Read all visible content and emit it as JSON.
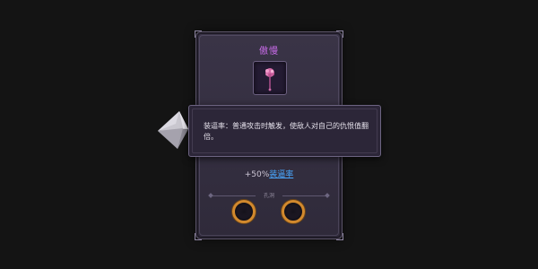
{
  "item": {
    "title": "傲慢",
    "icon": "pink-mace-staff-icon"
  },
  "tooltip": {
    "text": "装逼率：普通攻击时触发，使敌人对自己的仇恨值翻倍。"
  },
  "stat": {
    "value": "+50%",
    "link_label": "装逼率"
  },
  "sockets": {
    "section_label": "孔洞",
    "count": 2
  },
  "colors": {
    "background": "#141414",
    "card": "#332d40",
    "title": "#c86be8",
    "link": "#4aa8ff",
    "socket_ring": "#d2892d"
  }
}
